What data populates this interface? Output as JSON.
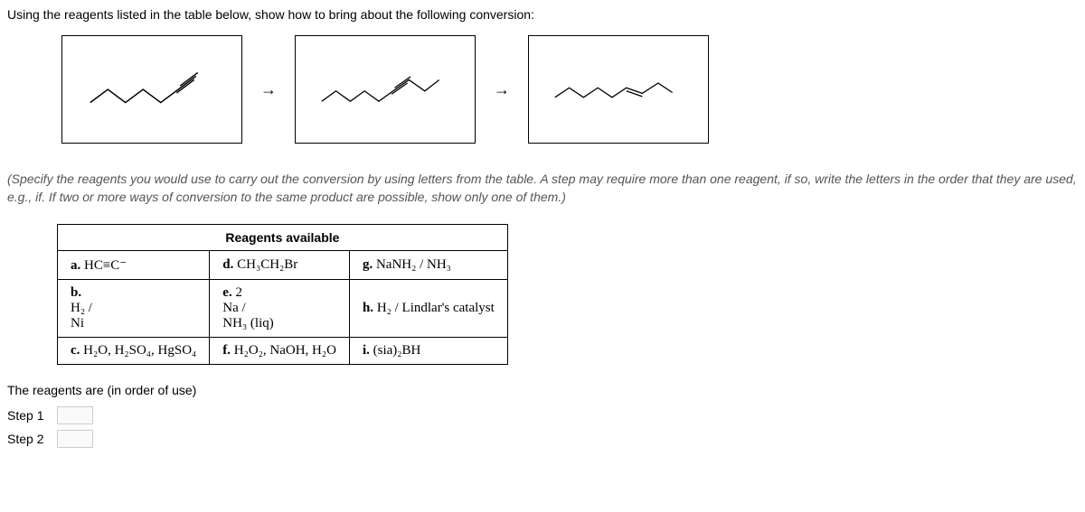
{
  "intro": "Using the reagents listed in the table below, show how to bring about the following conversion:",
  "arrow": "→",
  "instruction": "(Specify the reagents you would use to carry out the conversion by using letters from the table. A step may require more than one reagent, if so, write the letters in the order that they are used, e.g., if. If two or more ways of conversion to the same product are possible, show only one of them.)",
  "table": {
    "header": "Reagents available",
    "rows": [
      {
        "a_label": "a.",
        "a_content": "HC≡C⁻",
        "d_label": "d.",
        "d_content": "CH₃CH₂Br",
        "g_label": "g.",
        "g_content": "NaNH₂ / NH₃"
      },
      {
        "b_label": "b.",
        "b_line1": "H₂ /",
        "b_line2": "Ni",
        "e_label": "e.",
        "e_line0": "2",
        "e_line1": "Na /",
        "e_line2": "NH₃ (liq)",
        "h_label": "h.",
        "h_content": "H₂ / Lindlar's catalyst"
      },
      {
        "c_label": "c.",
        "c_content": "H₂O, H₂SO₄, HgSO₄",
        "f_label": "f.",
        "f_content": "H₂O₂, NaOH, H₂O",
        "i_label": "i.",
        "i_content": "(sia)₂BH"
      }
    ]
  },
  "footer": "The reagents are (in order of use)",
  "step1_label": "Step 1",
  "step2_label": "Step 2"
}
